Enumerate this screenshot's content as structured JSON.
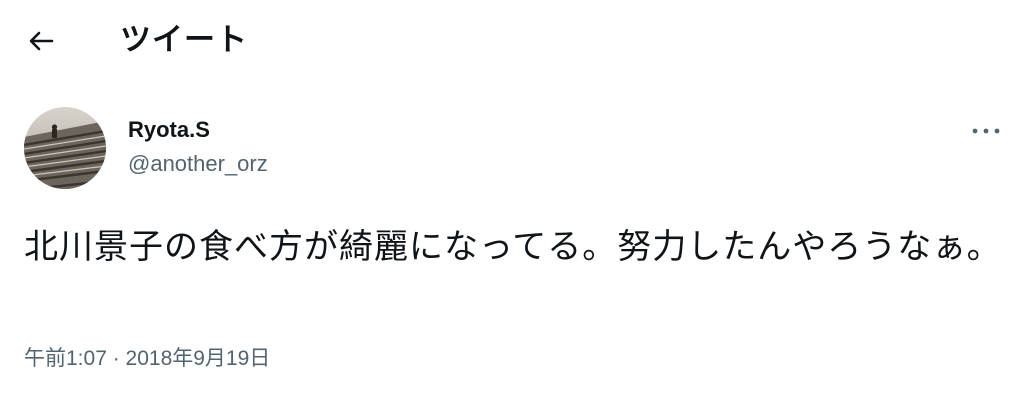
{
  "header": {
    "back_icon": "arrow-left-icon",
    "title": "ツイート"
  },
  "tweet": {
    "author": {
      "display_name": "Ryota.S",
      "handle": "@another_orz",
      "avatar_icon": "profile-photo"
    },
    "more_icon": "more-horizontal-icon",
    "text": "北川景子の食べ方が綺麗になってる。努力したんやろうなぁ。",
    "timestamp": "午前1:07 · 2018年9月19日"
  },
  "colors": {
    "text_primary": "#0f1419",
    "text_secondary": "#536471",
    "background": "#ffffff"
  }
}
